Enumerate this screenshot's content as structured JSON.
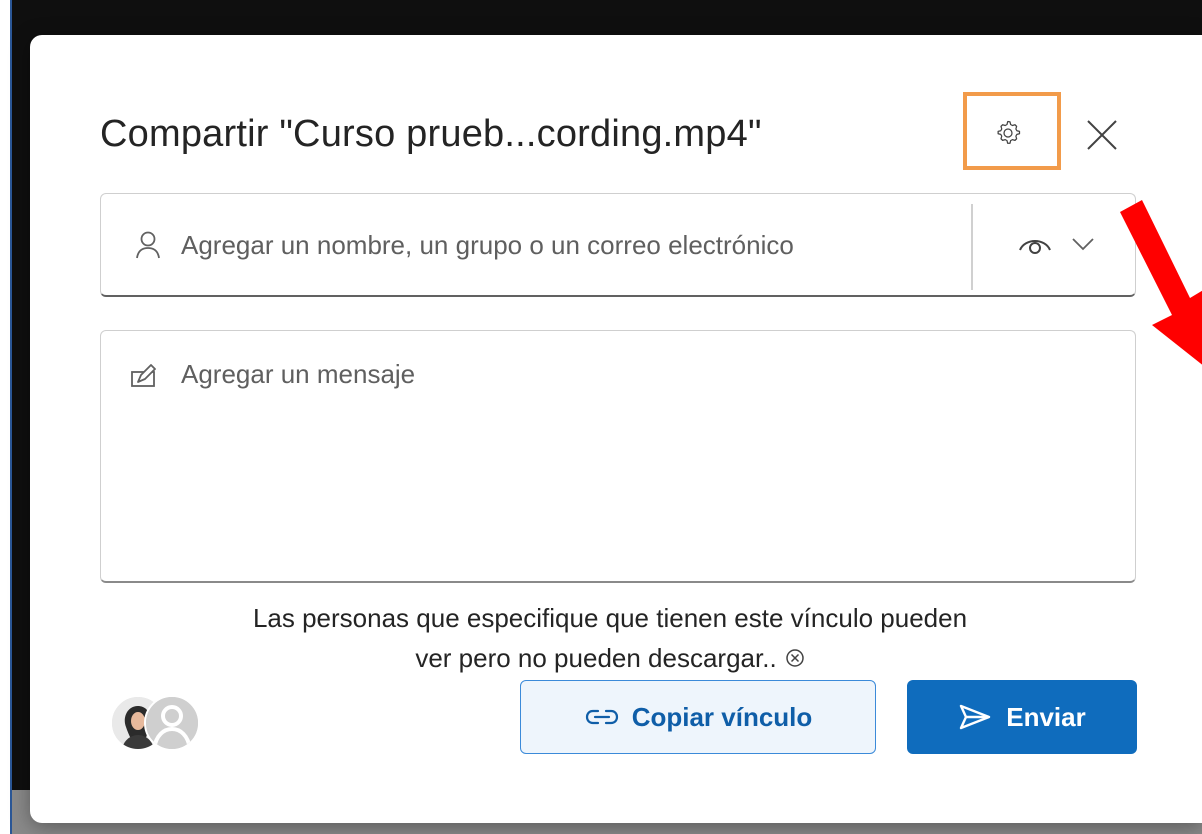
{
  "dialog": {
    "title": "Compartir \"Curso prueb...cording.mp4\"",
    "settings_icon": "gear-icon",
    "close_icon": "close-icon"
  },
  "people_field": {
    "icon": "person-icon",
    "placeholder": "Agregar un nombre, un grupo o un correo electrónico",
    "value": "",
    "permission_icon": "eye-icon",
    "permission_chevron": "chevron-down-icon"
  },
  "message_field": {
    "icon": "pencil-icon",
    "placeholder": "Agregar un mensaje",
    "value": ""
  },
  "info": {
    "line1": "Las personas que especifique que tienen este vínculo pueden",
    "line2": "ver pero no pueden descargar.."
  },
  "actions": {
    "copy_link_label": "Copiar vínculo",
    "send_label": "Enviar"
  },
  "colors": {
    "accent": "#0f6cbd",
    "highlight": "#f29b4a",
    "annotation_arrow": "#ff0000"
  }
}
